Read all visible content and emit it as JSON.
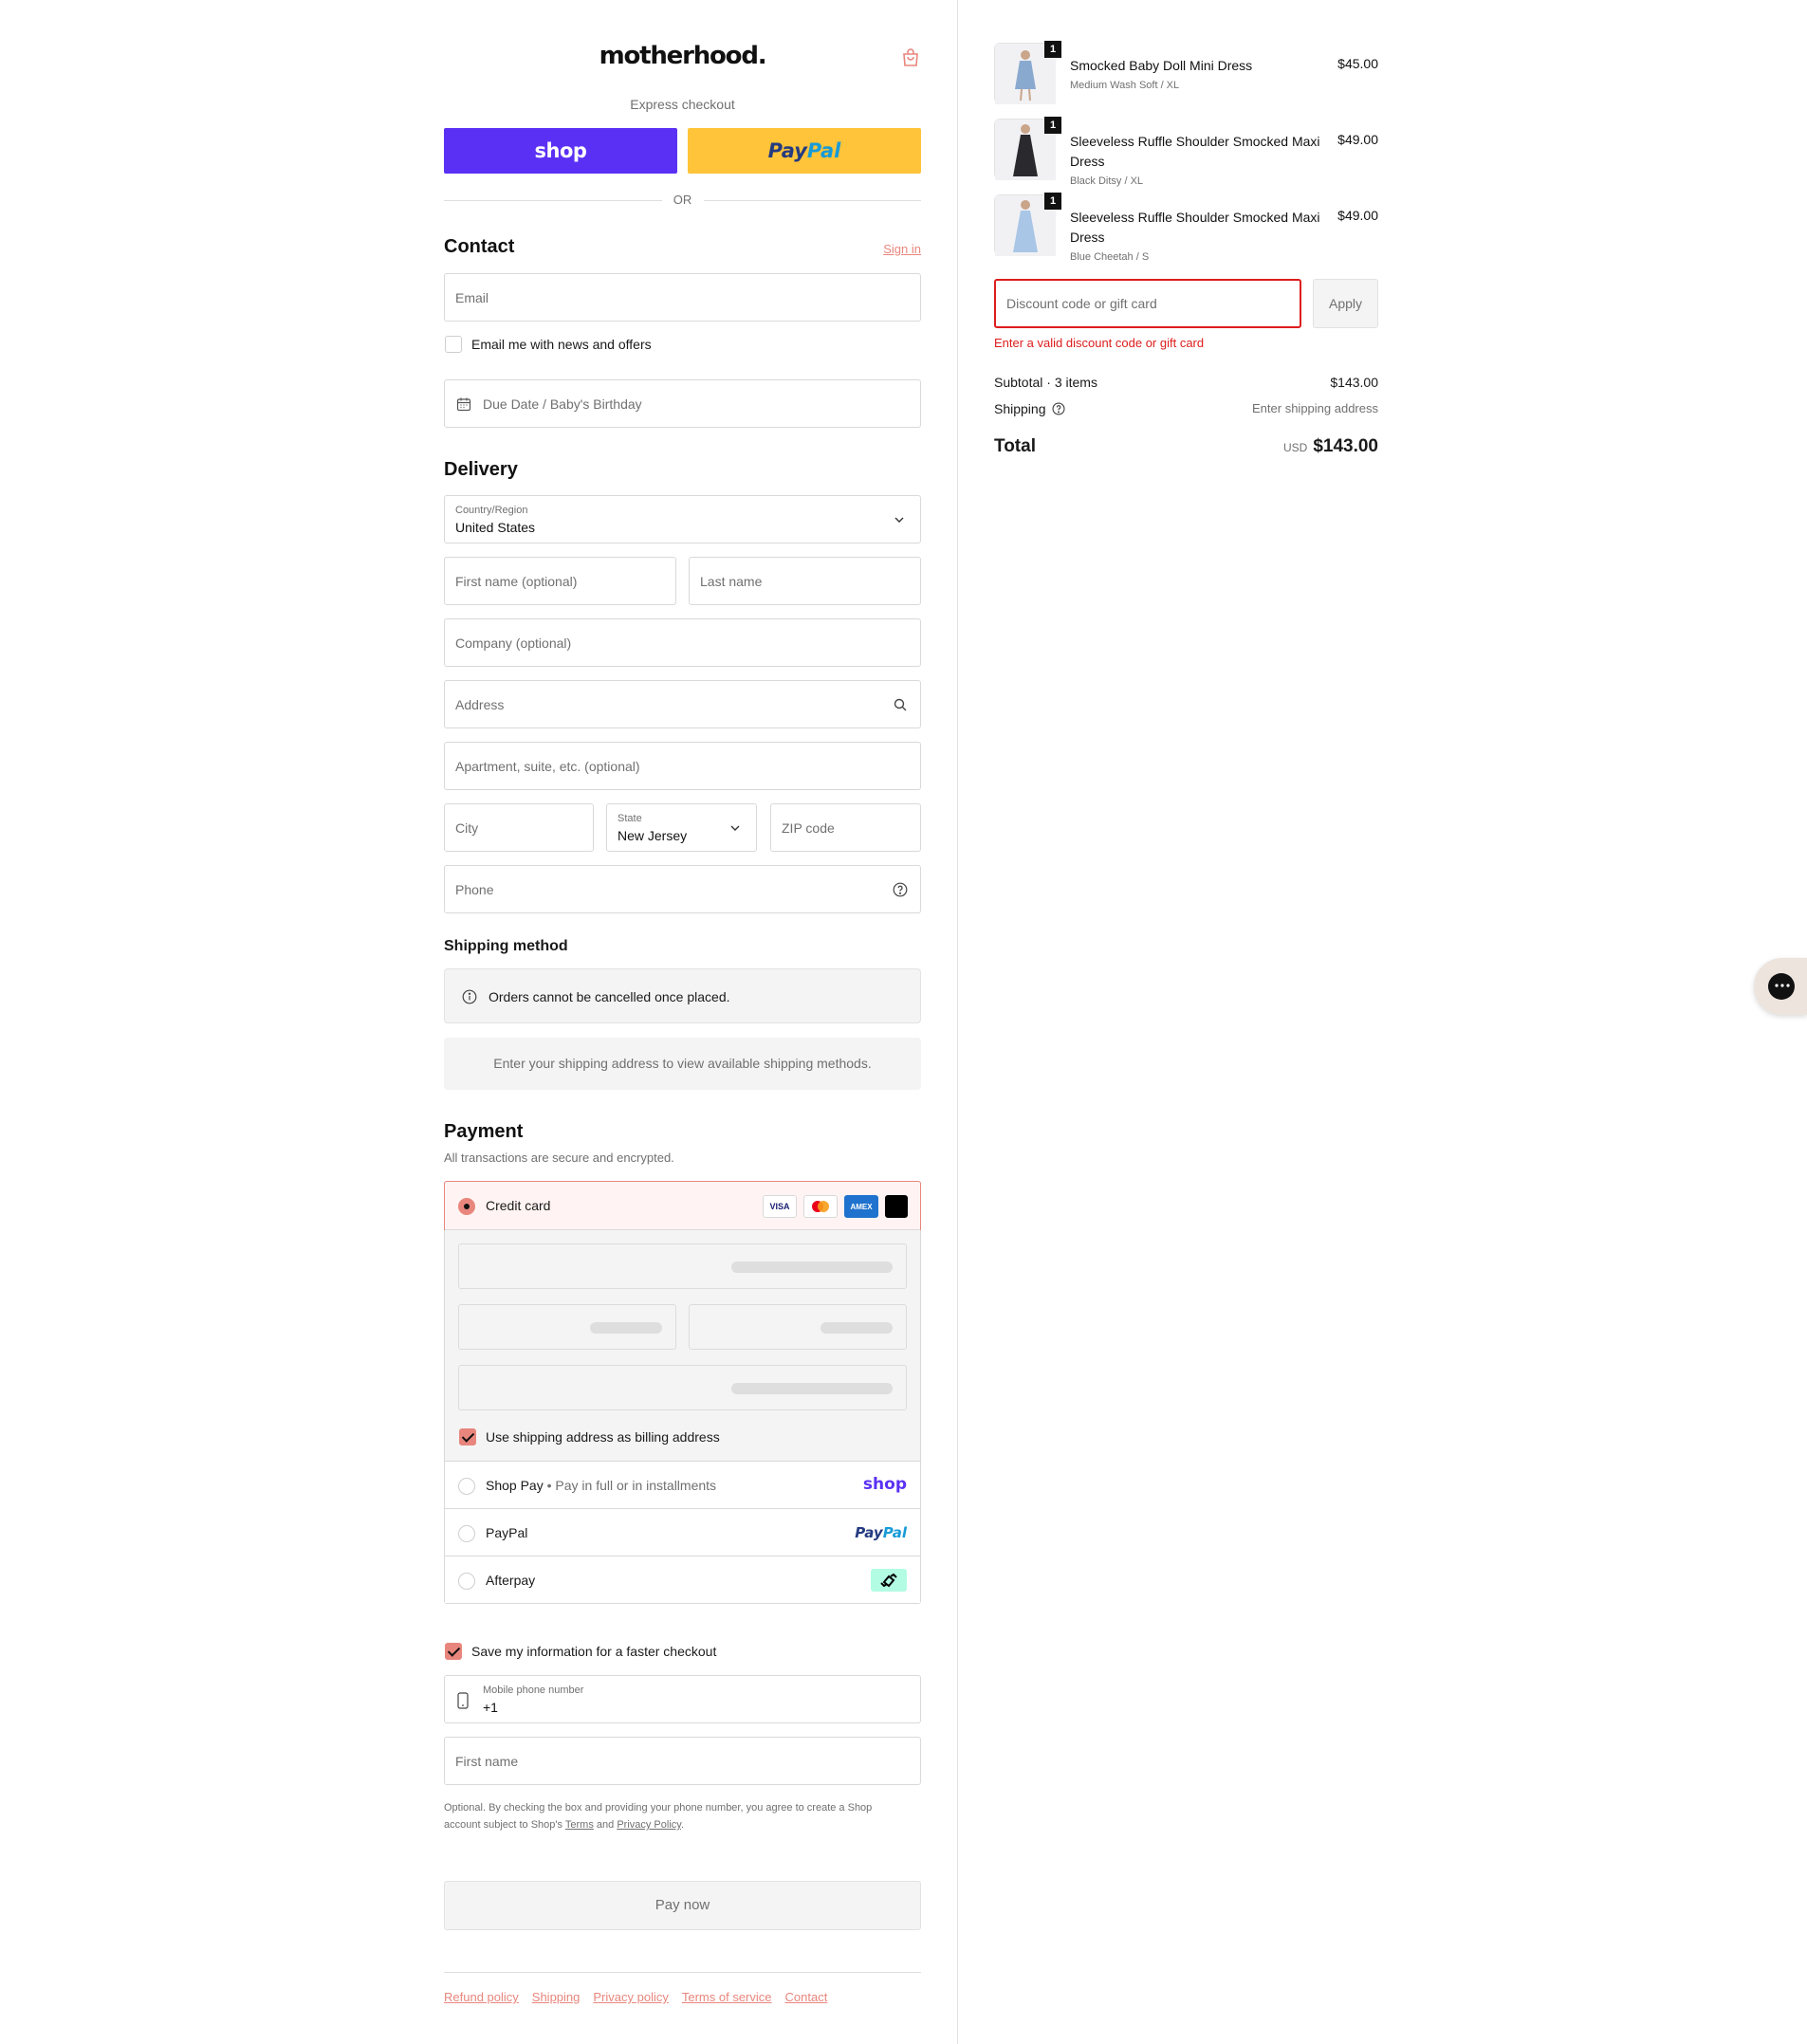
{
  "brand": {
    "logo": "motherhood."
  },
  "express": {
    "label": "Express checkout",
    "shop_label": "shop",
    "paypal_a": "Pay",
    "paypal_b": "Pal",
    "or": "OR"
  },
  "contact": {
    "title": "Contact",
    "sign_in": "Sign in",
    "email_placeholder": "Email",
    "newsletter_label": "Email me with news and offers",
    "due_date_placeholder": "Due Date / Baby's Birthday"
  },
  "delivery": {
    "title": "Delivery",
    "country_label": "Country/Region",
    "country_value": "United States",
    "first_name": "First name (optional)",
    "last_name": "Last name",
    "company": "Company (optional)",
    "address": "Address",
    "apartment": "Apartment, suite, etc. (optional)",
    "city": "City",
    "state_label": "State",
    "state_value": "New Jersey",
    "zip": "ZIP code",
    "phone": "Phone"
  },
  "shipping_method": {
    "title": "Shipping method",
    "notice": "Orders cannot be cancelled once placed.",
    "empty": "Enter your shipping address to view available shipping methods."
  },
  "payment": {
    "title": "Payment",
    "subtitle": "All transactions are secure and encrypted.",
    "credit_card": "Credit card",
    "brands": [
      "VISA",
      "AMEX"
    ],
    "billing_same": "Use shipping address as billing address",
    "shop_pay": "Shop Pay",
    "shop_pay_sub": "Pay in full or in installments",
    "shop_logo": "shop",
    "paypal": "PayPal",
    "paypal_logo_a": "Pay",
    "paypal_logo_b": "Pal",
    "afterpay": "Afterpay"
  },
  "remember": {
    "save_label": "Save my information for a faster checkout",
    "mobile_label": "Mobile phone number",
    "mobile_value": "+1",
    "first_name": "First name",
    "legal_1": "Optional. By checking the box and providing your phone number, you agree to create a Shop",
    "legal_2": "account subject to Shop's",
    "terms": "Terms",
    "and": "and",
    "privacy": "Privacy Policy",
    "period": "."
  },
  "pay_now": "Pay now",
  "footer": [
    "Refund policy",
    "Shipping",
    "Privacy policy",
    "Terms of service",
    "Contact"
  ],
  "summary": {
    "items": [
      {
        "qty": "1",
        "title": "Smocked Baby Doll Mini Dress",
        "variant": "Medium Wash Soft / XL",
        "price": "$45.00",
        "color": "#8aa9cf"
      },
      {
        "qty": "1",
        "title": "Sleeveless Ruffle Shoulder Smocked Maxi Dress",
        "variant": "Black Ditsy / XL",
        "price": "$49.00",
        "color": "#2a2a2e"
      },
      {
        "qty": "1",
        "title": "Sleeveless Ruffle Shoulder Smocked Maxi Dress",
        "variant": "Blue Cheetah / S",
        "price": "$49.00",
        "color": "#a9c6e6"
      }
    ],
    "discount_placeholder": "Discount code or gift card",
    "apply": "Apply",
    "error": "Enter a valid discount code or gift card",
    "subtotal_label": "Subtotal · 3 items",
    "subtotal_value": "$143.00",
    "shipping_label": "Shipping",
    "shipping_value": "Enter shipping address",
    "total_label": "Total",
    "currency": "USD",
    "total_value": "$143.00"
  },
  "colors": {
    "accent": "#e8867d",
    "shop": "#5a31f4",
    "paypal": "#ffc439",
    "error": "#dd1d1d"
  }
}
